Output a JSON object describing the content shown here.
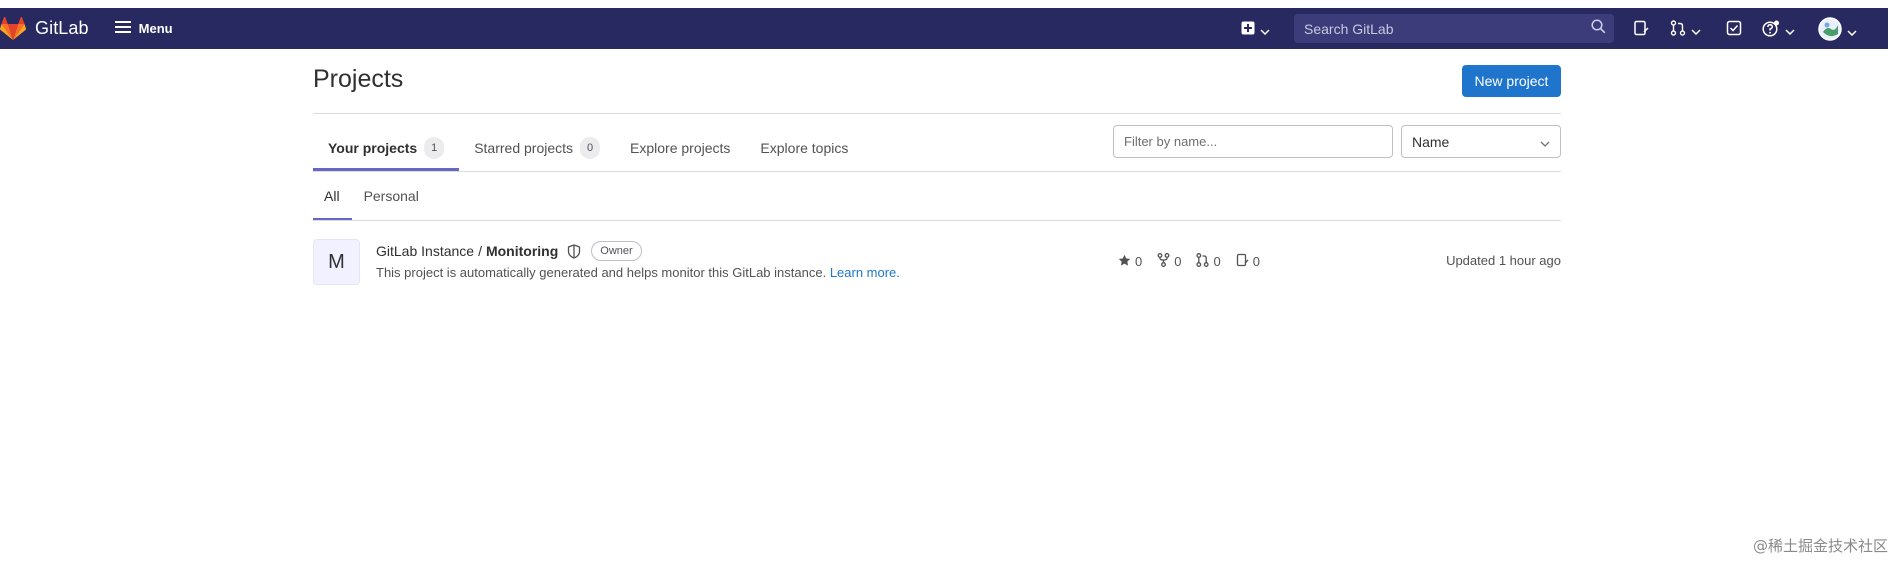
{
  "navbar": {
    "brand": "GitLab",
    "menu_label": "Menu",
    "search_placeholder": "Search GitLab",
    "colors": {
      "background": "#292961",
      "search_bg": "#3c3c7a"
    }
  },
  "page": {
    "title": "Projects",
    "new_project_label": "New project"
  },
  "tabs": [
    {
      "label": "Your projects",
      "count": "1",
      "active": true
    },
    {
      "label": "Starred projects",
      "count": "0",
      "active": false
    },
    {
      "label": "Explore projects",
      "active": false
    },
    {
      "label": "Explore topics",
      "active": false
    }
  ],
  "filter": {
    "placeholder": "Filter by name...",
    "sort_value": "Name"
  },
  "subtabs": [
    {
      "label": "All",
      "active": true
    },
    {
      "label": "Personal",
      "active": false
    }
  ],
  "project": {
    "avatar_letter": "M",
    "namespace": "GitLab Instance",
    "separator": "/",
    "name": "Monitoring",
    "role": "Owner",
    "description": "This project is automatically generated and helps monitor this GitLab instance.",
    "learn_more": "Learn more.",
    "stars": "0",
    "forks": "0",
    "merge_requests": "0",
    "issues": "0",
    "updated": "Updated 1 hour ago"
  },
  "watermark": "@稀土掘金技术社区",
  "accent_color": "#1f75cb"
}
